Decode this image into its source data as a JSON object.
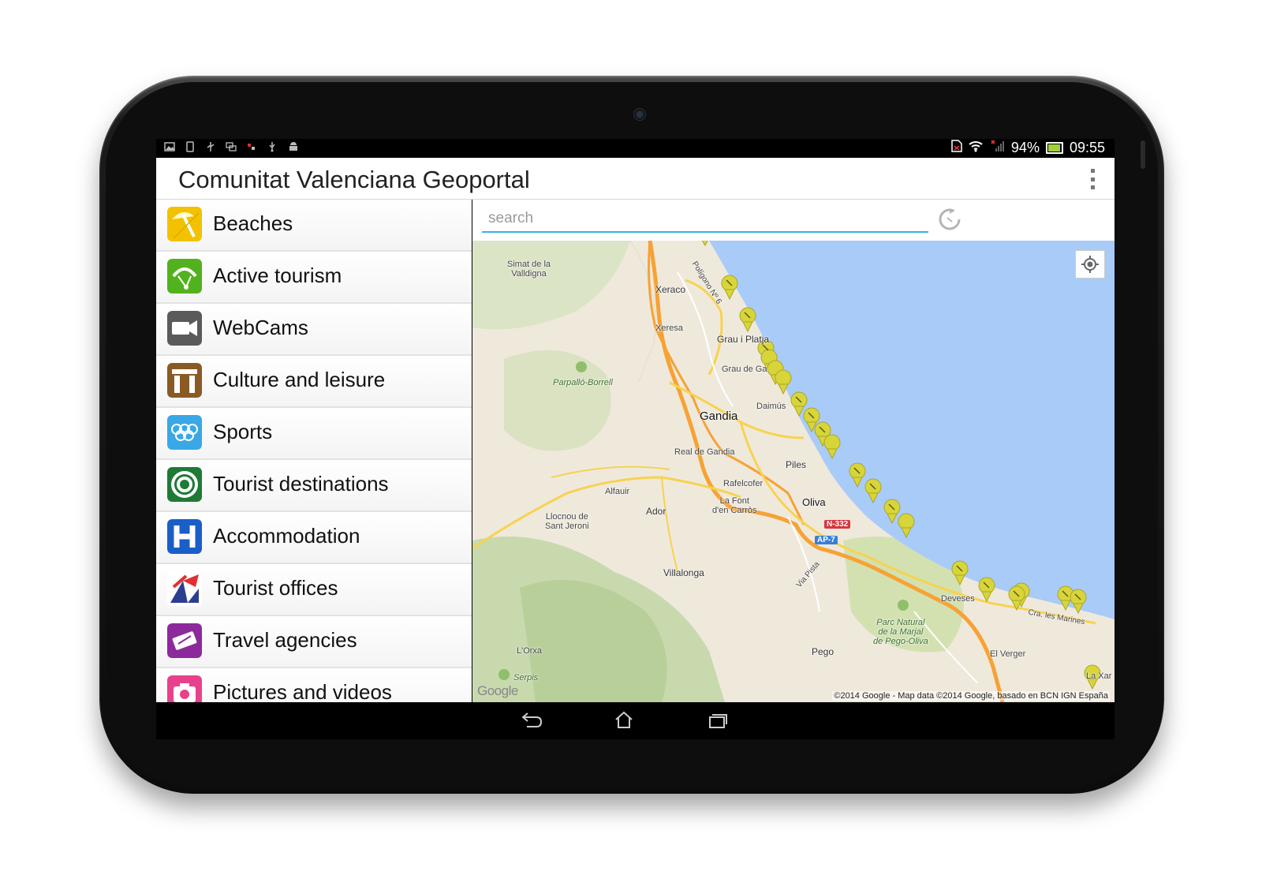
{
  "status_bar": {
    "battery_percent": "94%",
    "time": "09:55"
  },
  "app": {
    "title": "Comunitat Valenciana Geoportal"
  },
  "menu": {
    "items": [
      {
        "label": "Beaches",
        "icon": "beach-umbrella-icon",
        "color": "#f2c200"
      },
      {
        "label": "Active tourism",
        "icon": "paraglider-icon",
        "color": "#52b21e"
      },
      {
        "label": "WebCams",
        "icon": "webcam-icon",
        "color": "#5a5a5a"
      },
      {
        "label": "Culture and leisure",
        "icon": "monument-arch-icon",
        "color": "#8a5a25"
      },
      {
        "label": "Sports",
        "icon": "olympic-rings-icon",
        "color": "#3aa8e6"
      },
      {
        "label": "Tourist destinations",
        "icon": "destination-target-icon",
        "color": "#1e7a35"
      },
      {
        "label": "Accommodation",
        "icon": "hotel-h-icon",
        "color": "#1a5fc7"
      },
      {
        "label": "Tourist offices",
        "icon": "tourist-office-icon",
        "color": "#2c3e8f"
      },
      {
        "label": "Travel agencies",
        "icon": "travel-agency-icon",
        "color": "#8c2a9c"
      },
      {
        "label": "Pictures and videos",
        "icon": "camera-icon",
        "color": "#e8418c"
      }
    ]
  },
  "search": {
    "placeholder": "search",
    "value": ""
  },
  "map": {
    "places": {
      "simat": "Simat de la\nValldigna",
      "xeraco": "Xeraco",
      "xeresa": "Xeresa",
      "poligono": "Polígono Nº 6",
      "grau_platja": "Grau i Platja",
      "grau_gandia": "Grau de Ga",
      "parpallo": "Parpalló-Borrell",
      "gandia": "Gandia",
      "daimus": "Daimús",
      "real_gandia": "Real de Gandia",
      "piles": "Piles",
      "alfauir": "Alfauir",
      "rafelcofer": "Rafelcofer",
      "font": "La Font\nd'en Carròs",
      "oliva": "Oliva",
      "llocnou": "Llocnou de\nSant Jeroni",
      "ador": "Ador",
      "villalonga": "Villalonga",
      "via_pista": "Via Pista",
      "deveses": "Deveses",
      "cra_marines": "Cra. les Marines",
      "parc_natural": "Parc Natural\nde la Marjal\nde Pego-Oliva",
      "lorxa": "L'Orxa",
      "pego": "Pego",
      "el_verger": "El Verger",
      "serpis": "Serpis",
      "la_xara": "La Xar"
    },
    "road_badges": {
      "n332": "N-332",
      "ap7": "AP-7"
    },
    "google_logo": "Google",
    "copyright": "©2014 Google - Map data ©2014 Google, basado en BCN IGN España",
    "water_color": "#a9cbf8",
    "land_color": "#efe9dc",
    "marker_color": "#d8d53a"
  }
}
